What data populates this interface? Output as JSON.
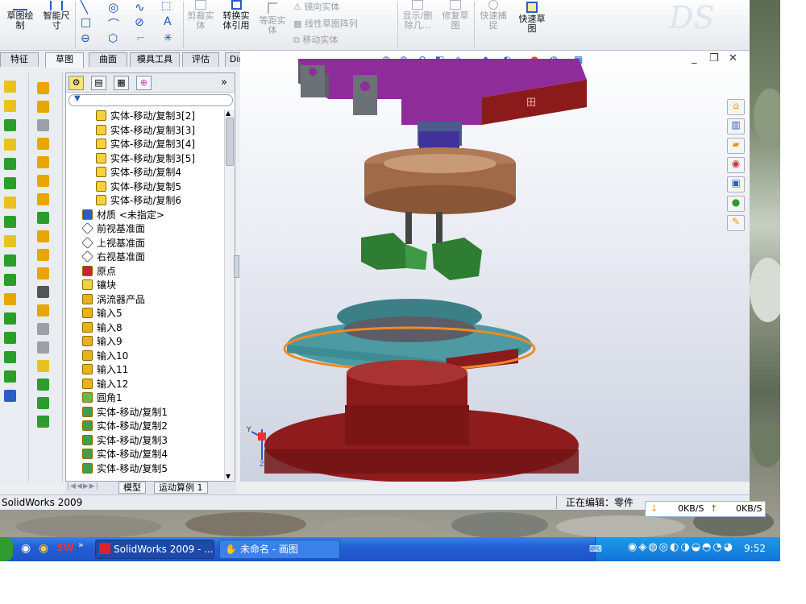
{
  "ribbon": {
    "sketch_draw": "草图绘\n制",
    "smart_dim": "智能尺\n寸",
    "trim": "剪裁实\n体",
    "convert": "转换实\n体引用",
    "offset": "等距实\n体",
    "mirror": "镜向实体",
    "linear_pattern": "线性草图阵列",
    "move": "移动实体",
    "show_delete": "显示/删\n除几...",
    "repair": "修复草\n图",
    "quick_snap": "快速捕\n捉",
    "rapid_sketch": "快速草\n图"
  },
  "tabs": [
    "特征",
    "草图",
    "曲面",
    "模具工具",
    "评估",
    "DimXpert"
  ],
  "active_tab": "草图",
  "tree": {
    "items": [
      {
        "label": "实体-移动/复制3[2]",
        "icon": "body-folder-icon",
        "indent": 1
      },
      {
        "label": "实体-移动/复制3[3]",
        "icon": "body-folder-icon",
        "indent": 1
      },
      {
        "label": "实体-移动/复制3[4]",
        "icon": "body-folder-icon",
        "indent": 1
      },
      {
        "label": "实体-移动/复制3[5]",
        "icon": "body-folder-icon",
        "indent": 1
      },
      {
        "label": "实体-移动/复制4",
        "icon": "body-folder-icon",
        "indent": 1
      },
      {
        "label": "实体-移动/复制5",
        "icon": "body-folder-icon",
        "indent": 1
      },
      {
        "label": "实体-移动/复制6",
        "icon": "body-folder-icon",
        "indent": 1
      },
      {
        "label": "材质 <未指定>",
        "icon": "material-icon",
        "indent": 0
      },
      {
        "label": "前视基准面",
        "icon": "plane-icon",
        "indent": 0
      },
      {
        "label": "上视基准面",
        "icon": "plane-icon",
        "indent": 0
      },
      {
        "label": "右视基准面",
        "icon": "plane-icon",
        "indent": 0
      },
      {
        "label": "原点",
        "icon": "origin-icon",
        "indent": 0
      },
      {
        "label": "镶块",
        "icon": "folder-icon",
        "indent": 0
      },
      {
        "label": "涡流器产品",
        "icon": "import-icon",
        "indent": 0
      },
      {
        "label": "输入5",
        "icon": "import-icon",
        "indent": 0
      },
      {
        "label": "输入8",
        "icon": "import-icon",
        "indent": 0
      },
      {
        "label": "输入9",
        "icon": "import-icon",
        "indent": 0
      },
      {
        "label": "输入10",
        "icon": "import-icon",
        "indent": 0
      },
      {
        "label": "输入11",
        "icon": "import-icon",
        "indent": 0
      },
      {
        "label": "输入12",
        "icon": "import-icon",
        "indent": 0
      },
      {
        "label": "圆角1",
        "icon": "fillet-icon",
        "indent": 0
      },
      {
        "label": "实体-移动/复制1",
        "icon": "move-copy-icon",
        "indent": 0
      },
      {
        "label": "实体-移动/复制2",
        "icon": "move-copy-icon",
        "indent": 0
      },
      {
        "label": "实体-移动/复制3",
        "icon": "move-copy-icon",
        "indent": 0
      },
      {
        "label": "实体-移动/复制4",
        "icon": "move-copy-icon",
        "indent": 0
      },
      {
        "label": "实体-移动/复制5",
        "icon": "move-copy-icon",
        "indent": 0
      }
    ]
  },
  "bottom_tabs": [
    "模型",
    "运动算例 1"
  ],
  "status": {
    "app": "SolidWorks 2009",
    "editing": "正在编辑：零件"
  },
  "net": {
    "down": "0KB/S",
    "up": "0KB/S"
  },
  "taskbar": {
    "item1": "SolidWorks 2009 - ...",
    "item2": "未命名 - 画图",
    "clock": "9:52"
  },
  "colors": {
    "accent": "#2459c7",
    "part_purple": "#8e2d9a",
    "part_red": "#8b1a1a",
    "part_teal": "#3d8c93",
    "part_brown": "#a06a48",
    "part_green": "#2e7d32",
    "highlight_orange": "#f08a24"
  }
}
